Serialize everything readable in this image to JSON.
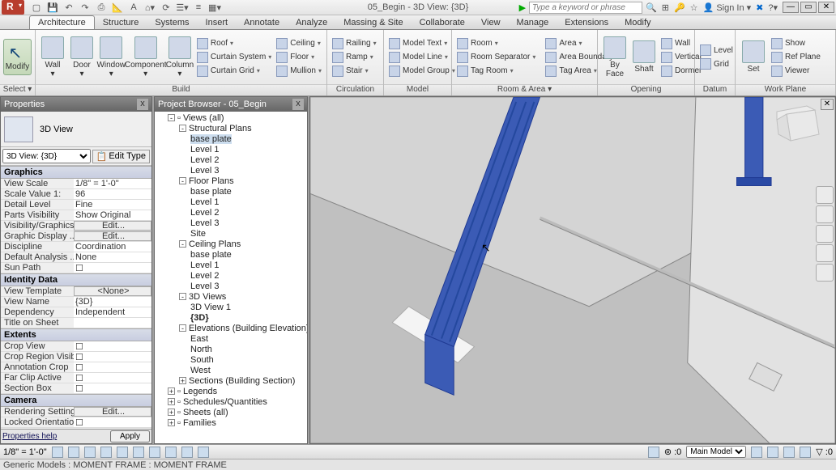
{
  "title": "05_Begin - 3D View: {3D}",
  "search_placeholder": "Type a keyword or phrase",
  "signin": "Sign In",
  "tabs": [
    "Architecture",
    "Structure",
    "Systems",
    "Insert",
    "Annotate",
    "Analyze",
    "Massing & Site",
    "Collaborate",
    "View",
    "Manage",
    "Extensions",
    "Modify"
  ],
  "active_tab": "Architecture",
  "ribbon": {
    "select": {
      "modify": "Modify",
      "label": "Select ▾"
    },
    "build": {
      "big": [
        "Wall",
        "Door",
        "Window",
        "Component",
        "Column"
      ],
      "stack": [
        [
          "Roof",
          "Curtain System",
          "Curtain Grid"
        ],
        [
          "Ceiling",
          "Floor",
          "Mullion"
        ]
      ],
      "label": "Build"
    },
    "circ": {
      "items": [
        "Railing",
        "Ramp",
        "Stair"
      ],
      "label": "Circulation"
    },
    "model": {
      "items": [
        "Model Text",
        "Model Line",
        "Model Group"
      ],
      "label": "Model"
    },
    "room": {
      "left": [
        "Room",
        "Room Separator",
        "Tag Room"
      ],
      "right": [
        "Area",
        "Area Boundary",
        "Tag Area"
      ],
      "label": "Room & Area ▾"
    },
    "opening": {
      "big": [
        "By Face",
        "Shaft"
      ],
      "stack": [
        "Wall",
        "Vertical",
        "Dormer"
      ],
      "label": "Opening"
    },
    "datum": {
      "items": [
        "Level",
        "Grid"
      ],
      "label": "Datum"
    },
    "wp": {
      "big": "Set",
      "stack": [
        "Show",
        "Ref Plane",
        "Viewer"
      ],
      "label": "Work Plane"
    }
  },
  "properties": {
    "title": "Properties",
    "type_name": "3D View",
    "instance_sel": "3D View: {3D}",
    "edit_type": "Edit Type",
    "cats": [
      {
        "name": "Graphics",
        "rows": [
          {
            "k": "View Scale",
            "v": "1/8\" = 1'-0\""
          },
          {
            "k": "Scale Value    1:",
            "v": "96"
          },
          {
            "k": "Detail Level",
            "v": "Fine"
          },
          {
            "k": "Parts Visibility",
            "v": "Show Original"
          },
          {
            "k": "Visibility/Graphics...",
            "v": "Edit...",
            "btn": true
          },
          {
            "k": "Graphic Display ...",
            "v": "Edit...",
            "btn": true
          },
          {
            "k": "Discipline",
            "v": "Coordination"
          },
          {
            "k": "Default Analysis ...",
            "v": "None"
          },
          {
            "k": "Sun Path",
            "v": "",
            "chk": true
          }
        ]
      },
      {
        "name": "Identity Data",
        "rows": [
          {
            "k": "View Template",
            "v": "<None>",
            "btn": true
          },
          {
            "k": "View Name",
            "v": "{3D}"
          },
          {
            "k": "Dependency",
            "v": "Independent"
          },
          {
            "k": "Title on Sheet",
            "v": ""
          }
        ]
      },
      {
        "name": "Extents",
        "rows": [
          {
            "k": "Crop View",
            "v": "",
            "chk": true
          },
          {
            "k": "Crop Region Visible",
            "v": "",
            "chk": true
          },
          {
            "k": "Annotation Crop",
            "v": "",
            "chk": true
          },
          {
            "k": "Far Clip Active",
            "v": "",
            "chk": true
          },
          {
            "k": "Section Box",
            "v": "",
            "chk": true
          }
        ]
      },
      {
        "name": "Camera",
        "rows": [
          {
            "k": "Rendering Settings",
            "v": "Edit...",
            "btn": true
          },
          {
            "k": "Locked Orientation",
            "v": "",
            "chk": true
          }
        ]
      }
    ],
    "help": "Properties help",
    "apply": "Apply"
  },
  "browser": {
    "title": "Project Browser - 05_Begin",
    "tree": [
      {
        "l": "Views (all)",
        "d": 1,
        "tg": "-",
        "ico": true
      },
      {
        "l": "Structural Plans",
        "d": 2,
        "tg": "-"
      },
      {
        "l": "base plate",
        "d": 3,
        "hl": true
      },
      {
        "l": "Level 1",
        "d": 3
      },
      {
        "l": "Level 2",
        "d": 3
      },
      {
        "l": "Level 3",
        "d": 3
      },
      {
        "l": "Floor Plans",
        "d": 2,
        "tg": "-"
      },
      {
        "l": "base plate",
        "d": 3
      },
      {
        "l": "Level 1",
        "d": 3
      },
      {
        "l": "Level 2",
        "d": 3
      },
      {
        "l": "Level 3",
        "d": 3
      },
      {
        "l": "Site",
        "d": 3
      },
      {
        "l": "Ceiling Plans",
        "d": 2,
        "tg": "-"
      },
      {
        "l": "base plate",
        "d": 3
      },
      {
        "l": "Level 1",
        "d": 3
      },
      {
        "l": "Level 2",
        "d": 3
      },
      {
        "l": "Level 3",
        "d": 3
      },
      {
        "l": "3D Views",
        "d": 2,
        "tg": "-"
      },
      {
        "l": "3D View 1",
        "d": 3
      },
      {
        "l": "{3D}",
        "d": 3,
        "bold": true
      },
      {
        "l": "Elevations (Building Elevation)",
        "d": 2,
        "tg": "-"
      },
      {
        "l": "East",
        "d": 3
      },
      {
        "l": "North",
        "d": 3
      },
      {
        "l": "South",
        "d": 3
      },
      {
        "l": "West",
        "d": 3
      },
      {
        "l": "Sections (Building Section)",
        "d": 2,
        "tg": "+"
      },
      {
        "l": "Legends",
        "d": 1,
        "tg": "+",
        "ico": true
      },
      {
        "l": "Schedules/Quantities",
        "d": 1,
        "tg": "+",
        "ico": true
      },
      {
        "l": "Sheets (all)",
        "d": 1,
        "tg": "+",
        "ico": true
      },
      {
        "l": "Families",
        "d": 1,
        "tg": "+",
        "ico": true
      }
    ]
  },
  "viewbar": {
    "scale": "1/8\" = 1'-0\"",
    "worksets": "Main Model"
  },
  "status": "Generic Models : MOMENT FRAME : MOMENT FRAME"
}
